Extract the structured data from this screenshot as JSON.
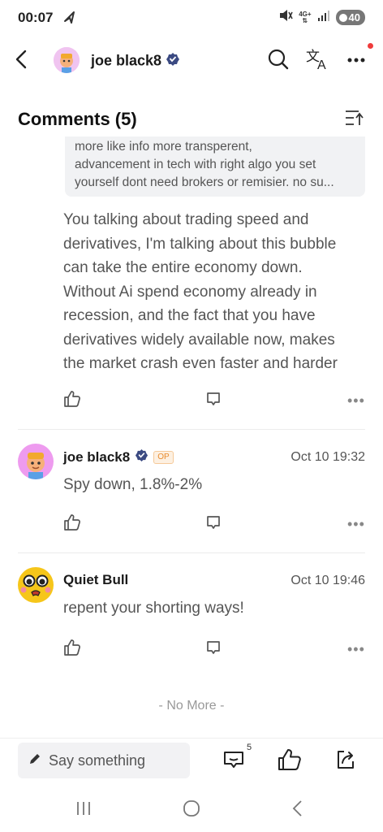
{
  "status_bar": {
    "time": "00:07",
    "network": "4G+",
    "battery": "40"
  },
  "header": {
    "name": "joe black8",
    "icons": [
      "back-icon",
      "search-icon",
      "translate-icon",
      "more-icon"
    ]
  },
  "comments_section": {
    "title": "Comments (5)"
  },
  "quoted_comment": {
    "lines": [
      "more like info more transperent,",
      "advancement in tech with right algo you set",
      "yourself dont need brokers or remisier. no su..."
    ]
  },
  "reply": {
    "lines": [
      "You talking about trading speed and",
      "derivatives, I'm talking about this bubble",
      "can take the entire economy down.",
      "Without Ai spend economy already in",
      "recession, and the fact that you have",
      "derivatives widely available now, makes",
      "the market crash even faster and harder"
    ]
  },
  "comments": [
    {
      "author": "joe black8",
      "badge": "OP",
      "time": "Oct 10 19:32",
      "text": "Spy down, 1.8%-2%"
    },
    {
      "author": "Quiet Bull",
      "time": "Oct 10 19:46",
      "text": "repent your shorting ways!"
    }
  ],
  "footer_note": "- No More -",
  "bottom_bar": {
    "input_placeholder": "Say something",
    "comment_count": "5"
  },
  "more_glyph": "•••",
  "colors": {
    "accent_orange": "#e88b2e",
    "notification_red": "#ef3b3b",
    "muted_text": "#555555"
  }
}
